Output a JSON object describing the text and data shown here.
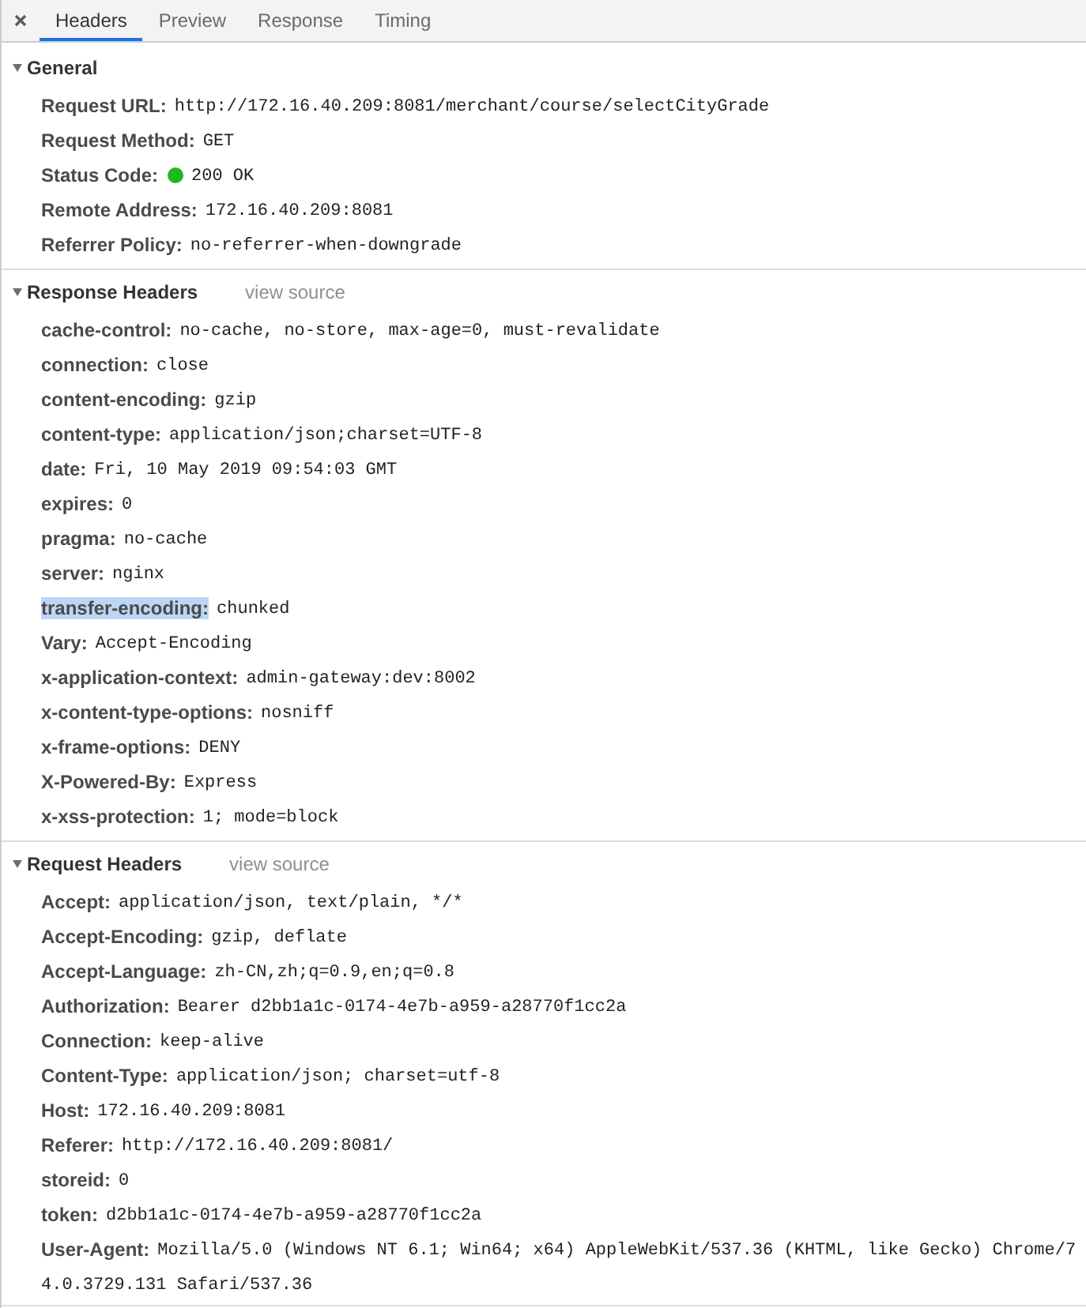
{
  "tabs": [
    {
      "label": "Headers",
      "selected": true
    },
    {
      "label": "Preview",
      "selected": false
    },
    {
      "label": "Response",
      "selected": false
    },
    {
      "label": "Timing",
      "selected": false
    }
  ],
  "sections": [
    {
      "title": "General",
      "expanded": true,
      "rows": [
        {
          "name": "Request URL:",
          "value": "http://172.16.40.209:8081/merchant/course/selectCityGrade",
          "highlighted": false
        },
        {
          "name": "Request Method:",
          "value": "GET",
          "highlighted": false
        },
        {
          "name": "Status Code:",
          "value": "200 OK",
          "color": "#1fb81f",
          "highlighted": false
        },
        {
          "name": "Remote Address:",
          "value": "172.16.40.209:8081",
          "highlighted": false
        },
        {
          "name": "Referrer Policy:",
          "value": "no-referrer-when-downgrade",
          "highlighted": false
        }
      ]
    },
    {
      "title": "Response Headers",
      "expanded": true,
      "view_source": "view source",
      "rows": [
        {
          "name": "cache-control:",
          "value": "no-cache, no-store, max-age=0, must-revalidate",
          "highlighted": false
        },
        {
          "name": "connection:",
          "value": "close",
          "highlighted": false
        },
        {
          "name": "content-encoding:",
          "value": "gzip",
          "highlighted": false
        },
        {
          "name": "content-type:",
          "value": "application/json;charset=UTF-8",
          "highlighted": false
        },
        {
          "name": "date:",
          "value": "Fri, 10 May 2019 09:54:03 GMT",
          "highlighted": false
        },
        {
          "name": "expires:",
          "value": "0",
          "highlighted": false
        },
        {
          "name": "pragma:",
          "value": "no-cache",
          "highlighted": false
        },
        {
          "name": "server:",
          "value": "nginx",
          "highlighted": false
        },
        {
          "name": "transfer-encoding:",
          "value": "chunked",
          "highlighted": true
        },
        {
          "name": "Vary:",
          "value": "Accept-Encoding",
          "highlighted": false
        },
        {
          "name": "x-application-context:",
          "value": "admin-gateway:dev:8002",
          "highlighted": false
        },
        {
          "name": "x-content-type-options:",
          "value": "nosniff",
          "highlighted": false
        },
        {
          "name": "x-frame-options:",
          "value": "DENY",
          "highlighted": false
        },
        {
          "name": "X-Powered-By:",
          "value": "Express",
          "highlighted": false
        },
        {
          "name": "x-xss-protection:",
          "value": "1; mode=block",
          "highlighted": false
        }
      ]
    },
    {
      "title": "Request Headers",
      "expanded": true,
      "view_source": "view source",
      "rows": [
        {
          "name": "Accept:",
          "value": "application/json, text/plain, */*",
          "highlighted": false
        },
        {
          "name": "Accept-Encoding:",
          "value": "gzip, deflate",
          "highlighted": false
        },
        {
          "name": "Accept-Language:",
          "value": "zh-CN,zh;q=0.9,en;q=0.8",
          "highlighted": false
        },
        {
          "name": "Authorization:",
          "value": "Bearer d2bb1a1c-0174-4e7b-a959-a28770f1cc2a",
          "highlighted": false
        },
        {
          "name": "Connection:",
          "value": "keep-alive",
          "highlighted": false
        },
        {
          "name": "Content-Type:",
          "value": "application/json; charset=utf-8",
          "highlighted": false
        },
        {
          "name": "Host:",
          "value": "172.16.40.209:8081",
          "highlighted": false
        },
        {
          "name": "Referer:",
          "value": "http://172.16.40.209:8081/",
          "highlighted": false
        },
        {
          "name": "storeid:",
          "value": "0",
          "highlighted": false
        },
        {
          "name": "token:",
          "value": "d2bb1a1c-0174-4e7b-a959-a28770f1cc2a",
          "highlighted": false
        },
        {
          "name": "User-Agent:",
          "value": "Mozilla/5.0 (Windows NT 6.1; Win64; x64) AppleWebKit/537.36 (KHTML, like Gecko) Chrome/74.0.3729.131 Safari/537.36",
          "highlighted": false
        }
      ]
    }
  ]
}
